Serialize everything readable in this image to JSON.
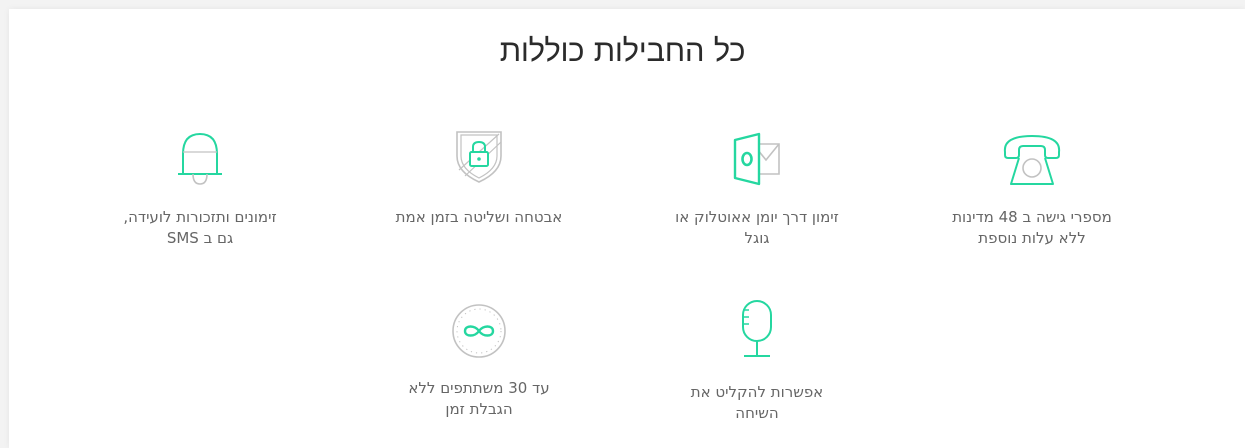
{
  "section": {
    "title": "כל החבילות כוללות"
  },
  "features": [
    {
      "icon": "phone-icon",
      "label": "מספרי גישה ב 48 מדינות\nללא עלות נוספת"
    },
    {
      "icon": "outlook-calendar-icon",
      "label": "זימון דרך יומן אאוטלוק או\nגוגל"
    },
    {
      "icon": "security-shield-lock-icon",
      "label": "אבטחה ושליטה בזמן אמת"
    },
    {
      "icon": "bell-icon",
      "label": "זימונים ותזכורות לועידה,\nגם ב SMS"
    },
    {
      "icon": "microphone-icon",
      "label": "אפשרות להקליט את\nהשיחה"
    },
    {
      "icon": "infinity-timer-icon",
      "label": "עד 30 משתתפים ללא\nהגבלת זמן"
    }
  ],
  "colors": {
    "accent": "#25d7a0",
    "icon_gray": "#c2c2c2",
    "text": "#666666",
    "title": "#2b2b2b"
  }
}
